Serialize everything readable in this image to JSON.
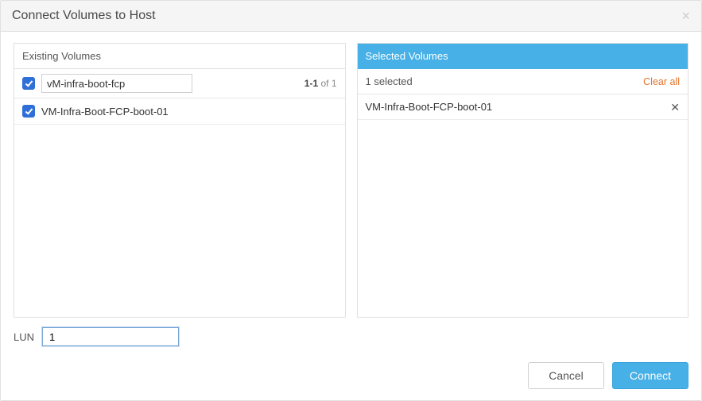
{
  "dialog": {
    "title": "Connect Volumes to Host"
  },
  "existing": {
    "header": "Existing Volumes",
    "search_value": "vM-infra-boot-fcp",
    "count_range": "1-1",
    "count_of": "of 1",
    "items": [
      {
        "label": "VM-Infra-Boot-FCP-boot-01",
        "checked": true
      }
    ],
    "select_all_checked": true
  },
  "selected": {
    "header": "Selected Volumes",
    "summary": "1 selected",
    "clear_label": "Clear all",
    "items": [
      {
        "label": "VM-Infra-Boot-FCP-boot-01"
      }
    ]
  },
  "lun": {
    "label": "LUN",
    "value": "1"
  },
  "buttons": {
    "cancel": "Cancel",
    "connect": "Connect"
  }
}
